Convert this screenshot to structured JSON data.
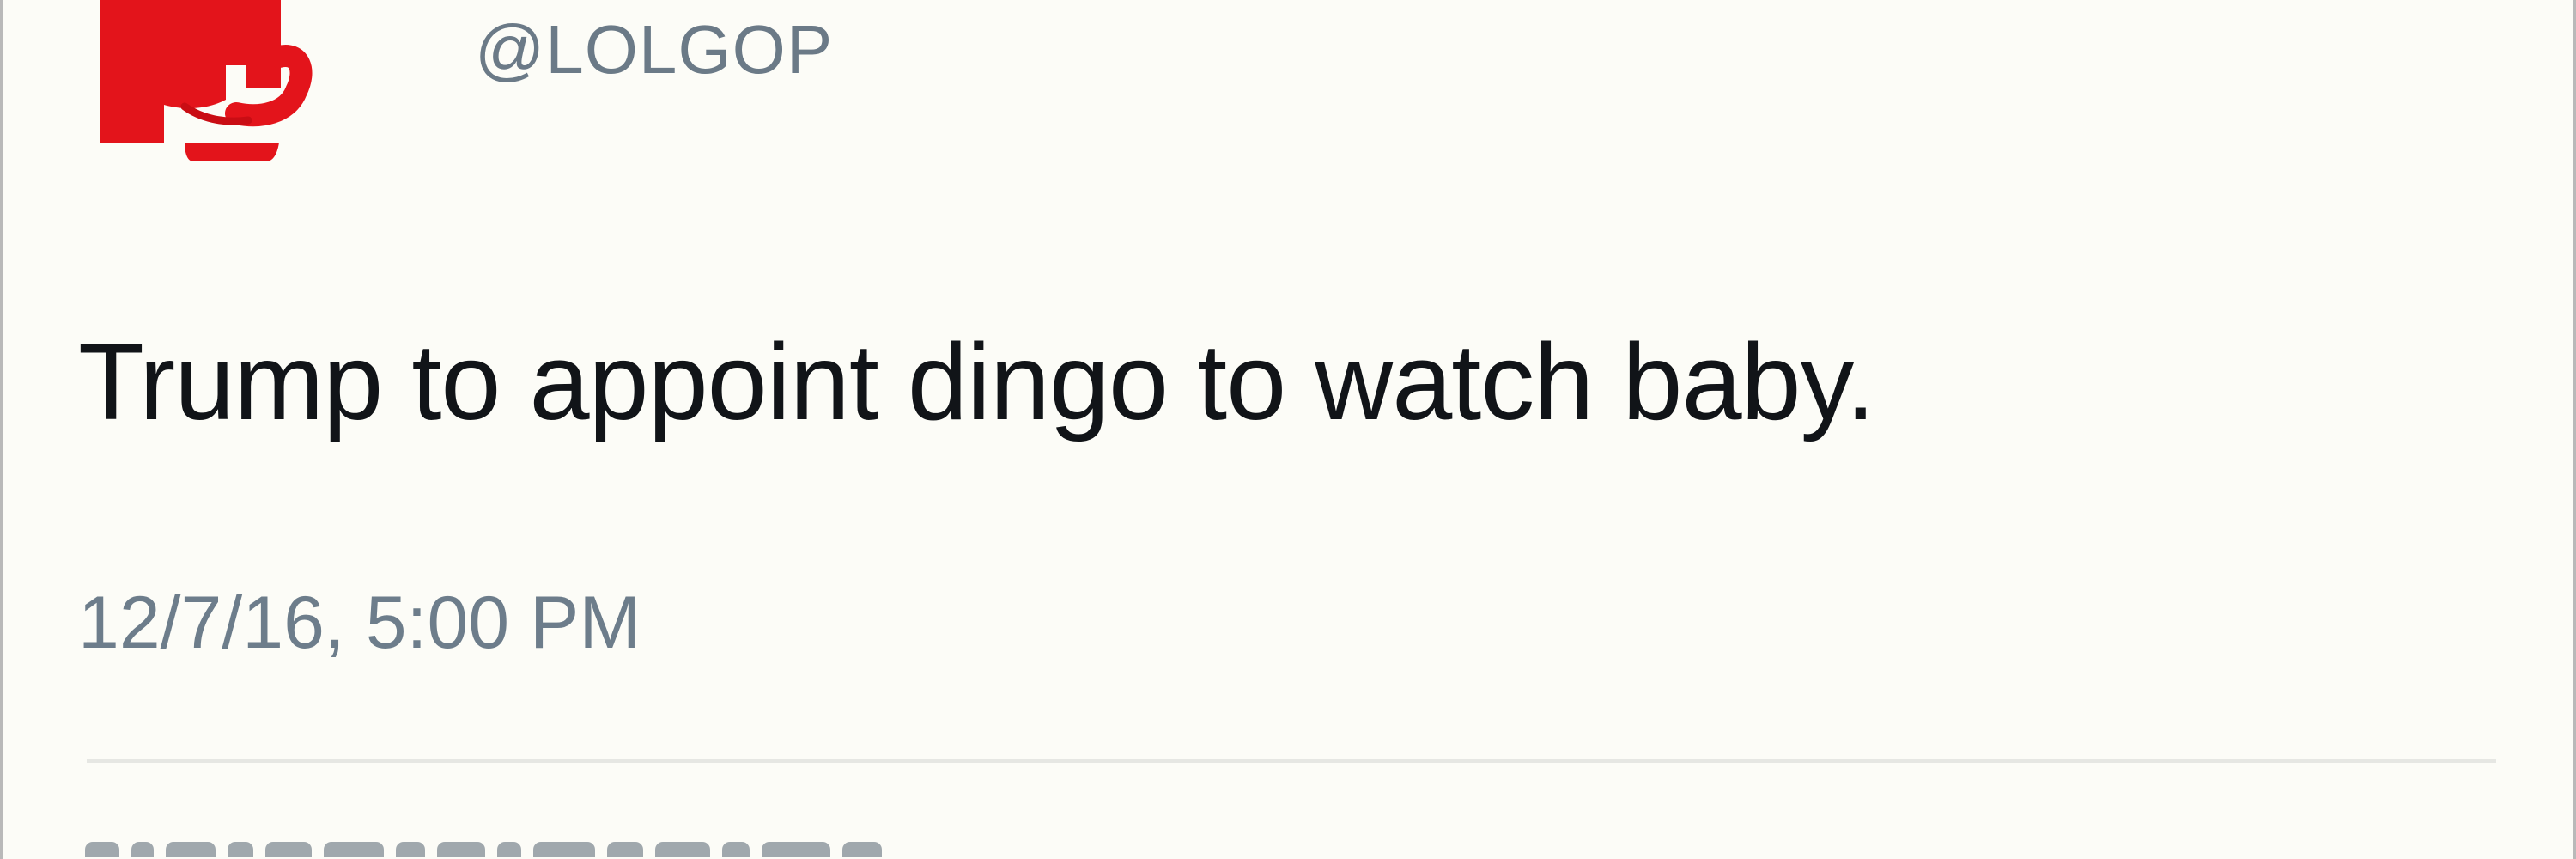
{
  "tweet": {
    "avatar_icon": "red-elephant-logo-icon",
    "handle": "@LOLGOP",
    "text": "Trump to appoint dingo to watch baby.",
    "timestamp": "12/7/16, 5:00 PM"
  },
  "colors": {
    "background": "#fcfcf7",
    "avatar_red": "#e3141b",
    "handle_gray": "#6b7a87",
    "text_black": "#111418",
    "timestamp_gray": "#6d7d8b",
    "divider": "#e6e7e3"
  }
}
